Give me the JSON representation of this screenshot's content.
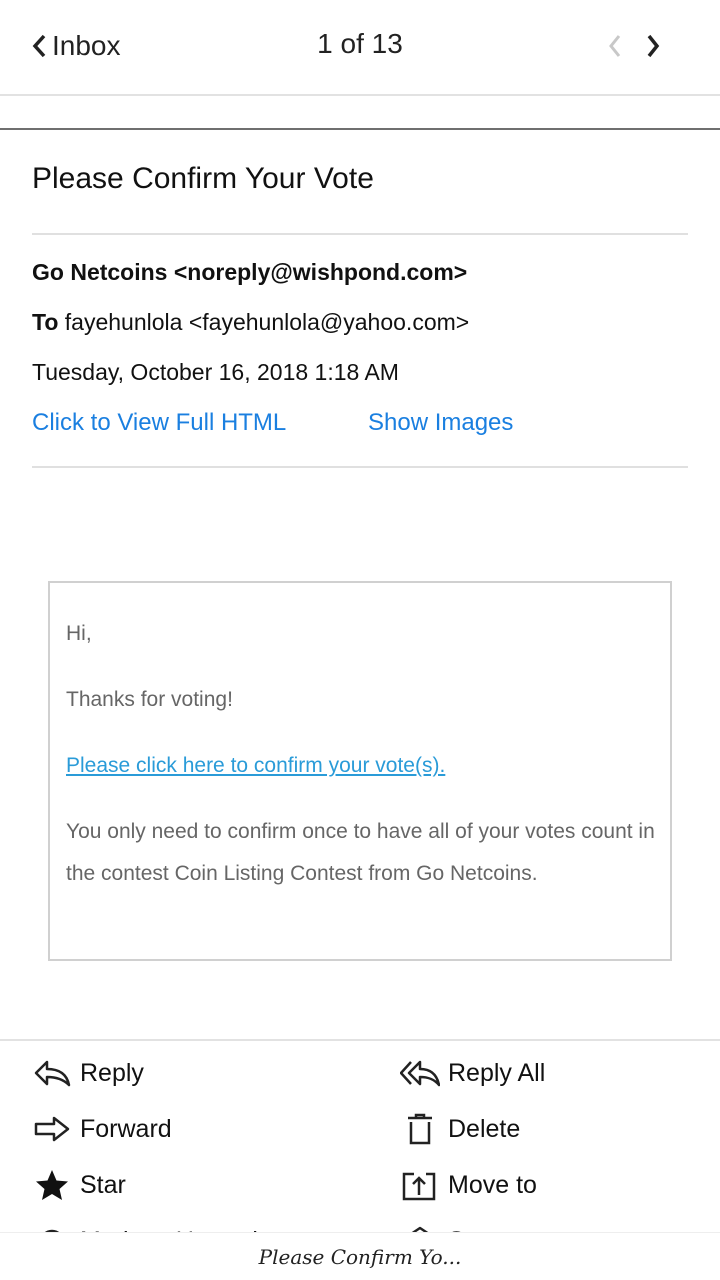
{
  "header": {
    "back_label": "Inbox",
    "counter": "1 of 13"
  },
  "email": {
    "subject": "Please Confirm Your Vote",
    "from": "Go Netcoins <noreply@wishpond.com>",
    "to_label": "To",
    "to_value": "fayehunlola <fayehunlola@yahoo.com>",
    "date": "Tuesday, October 16, 2018 1:18 AM",
    "view_html_link": "Click to View Full HTML",
    "show_images_link": "Show Images"
  },
  "body": {
    "greeting": "Hi,",
    "thanks": "Thanks for voting!",
    "confirm_link": "Please click here to confirm your vote(s).",
    "info": "You only need to confirm once to have all of your votes count in the contest Coin Listing Contest from Go Netcoins."
  },
  "actions": {
    "reply": "Reply",
    "reply_all": "Reply All",
    "forward": "Forward",
    "delete": "Delete",
    "star": "Star",
    "move_to": "Move to",
    "mark_unread": "Mark as Unread",
    "spam": "Spam"
  },
  "footer": {
    "tab_title": "Please Confirm Yo..."
  },
  "colors": {
    "link": "#1a7fe0",
    "body_link": "#2a9bd8"
  }
}
